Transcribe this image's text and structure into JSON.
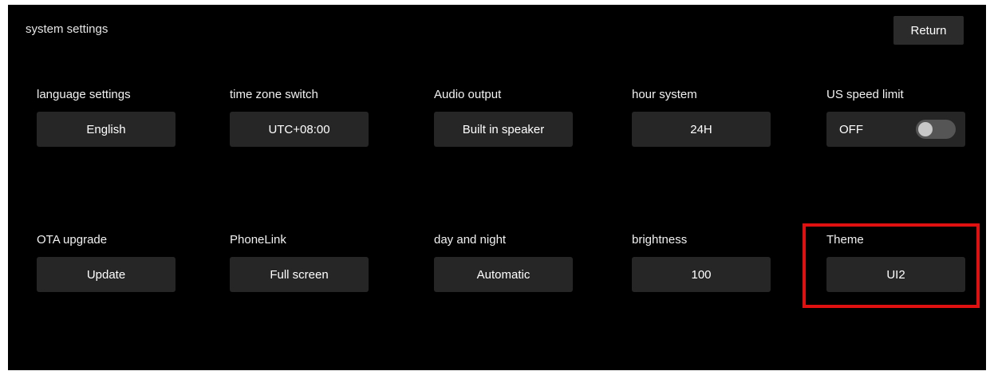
{
  "header": {
    "title": "system settings",
    "return_label": "Return"
  },
  "settings": [
    {
      "label": "language settings",
      "value": "English"
    },
    {
      "label": "time zone switch",
      "value": "UTC+08:00"
    },
    {
      "label": "Audio output",
      "value": "Built in speaker"
    },
    {
      "label": "hour system",
      "value": "24H"
    },
    {
      "label": "US speed limit",
      "value": "OFF",
      "toggle_on": false
    },
    {
      "label": "OTA upgrade",
      "value": "Update"
    },
    {
      "label": "PhoneLink",
      "value": "Full screen"
    },
    {
      "label": "day and night",
      "value": "Automatic"
    },
    {
      "label": "brightness",
      "value": "100"
    },
    {
      "label": "Theme",
      "value": "UI2"
    }
  ],
  "annotation": {
    "highlight_color": "#e01010",
    "highlighted_setting": "Theme"
  },
  "colors": {
    "background": "#000000",
    "button": "#262626",
    "text": "#ffffff"
  }
}
